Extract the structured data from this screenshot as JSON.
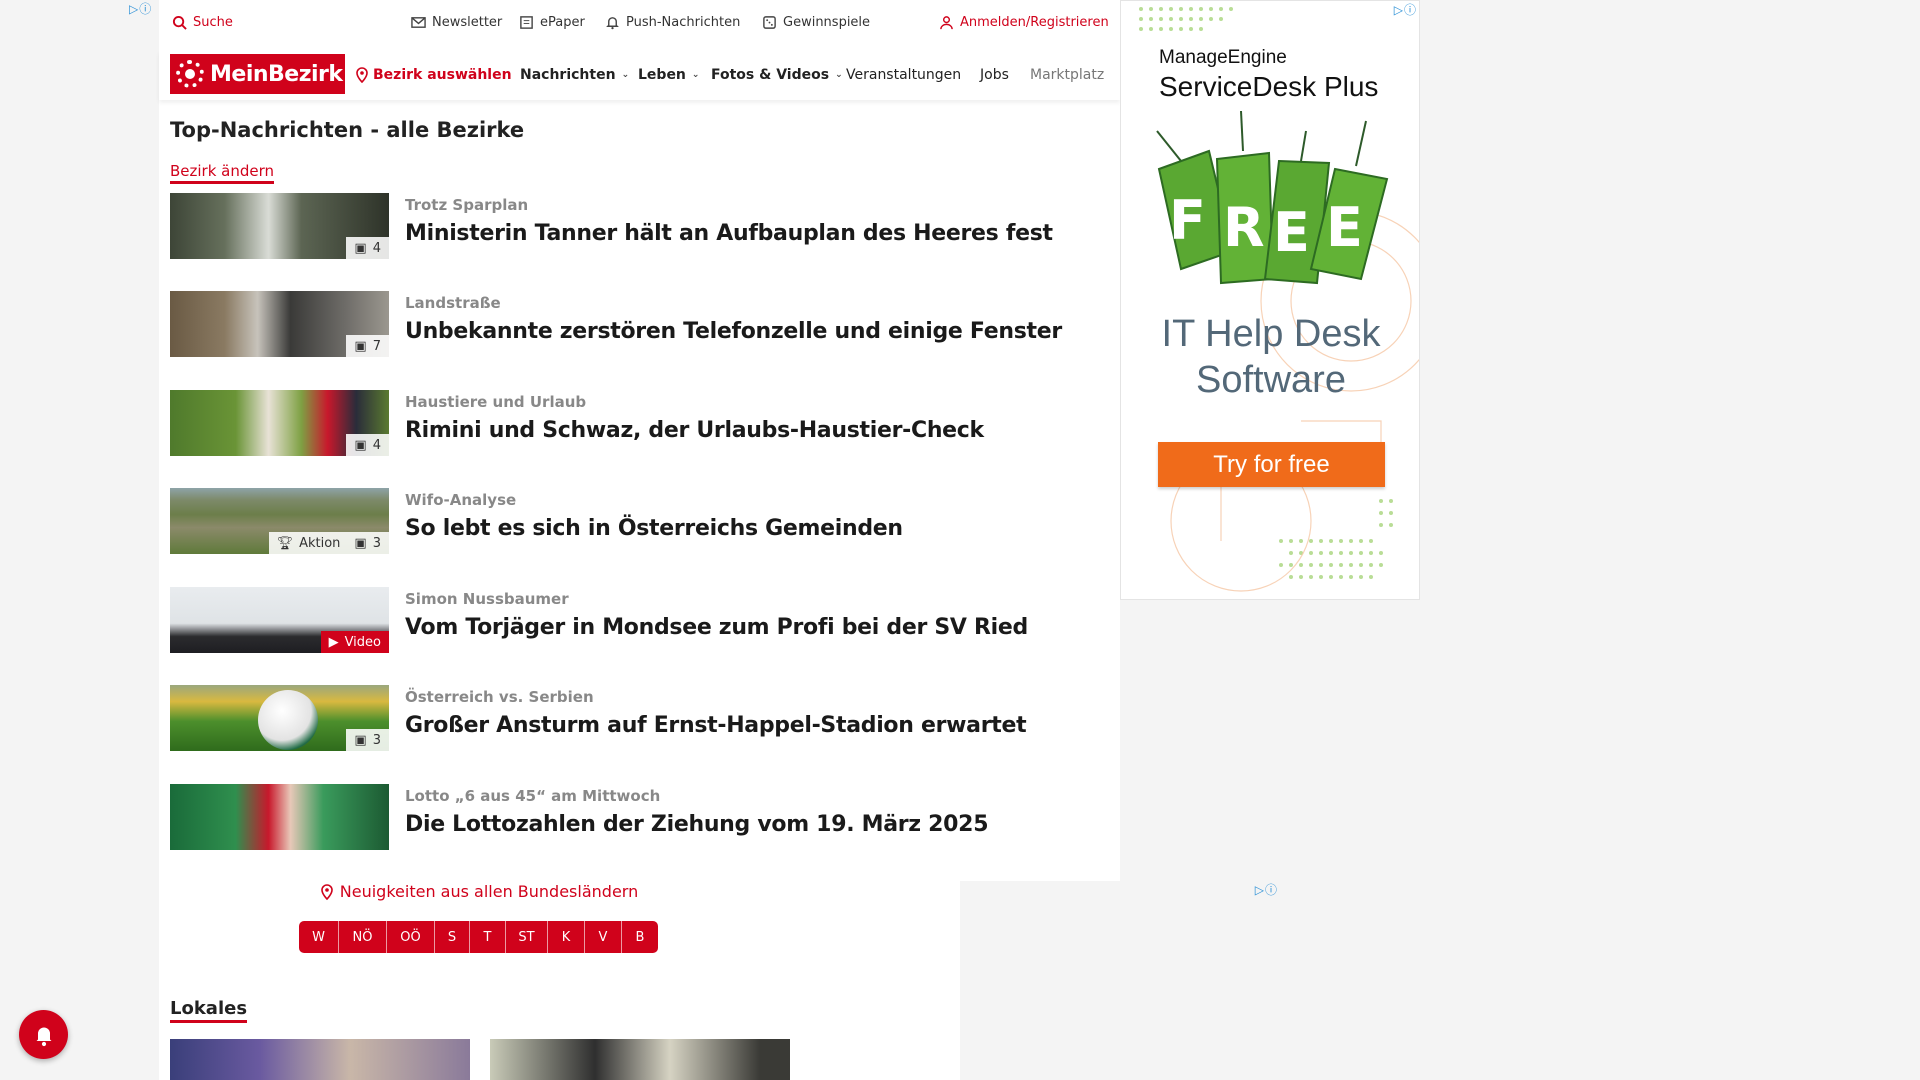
{
  "topbar": {
    "search": "Suche",
    "newsletter": "Newsletter",
    "epaper": "ePaper",
    "push": "Push-Nachrichten",
    "gewinnspiele": "Gewinnspiele",
    "login": "Anmelden/Registrieren"
  },
  "nav": {
    "logo": "MeinBezirk",
    "bezirk": "Bezirk auswählen",
    "nachrichten": "Nachrichten",
    "leben": "Leben",
    "fotos": "Fotos & Videos",
    "veranstaltungen": "Veranstaltungen",
    "jobs": "Jobs",
    "marktplatz": "Marktplatz"
  },
  "section": {
    "title": "Top-Nachrichten - alle Bezirke",
    "change_link": "Bezirk ändern"
  },
  "articles": [
    {
      "kicker": "Trotz Sparplan",
      "title": "Ministerin Tanner hält an Aufbauplan des Heeres fest",
      "badge": "4",
      "aktion": "",
      "video": ""
    },
    {
      "kicker": "Landstraße",
      "title": "Unbekannte zerstören Telefonzelle und einige Fenster",
      "badge": "7",
      "aktion": "",
      "video": ""
    },
    {
      "kicker": "Haustiere und Urlaub",
      "title": "Rimini und Schwaz, der Urlaubs-Haustier-Check",
      "badge": "4",
      "aktion": "",
      "video": ""
    },
    {
      "kicker": "Wifo-Analyse",
      "title": "So lebt es sich in Österreichs Gemeinden",
      "badge": "3",
      "aktion": "Aktion",
      "video": ""
    },
    {
      "kicker": "Simon Nussbaumer",
      "title": "Vom Torjäger in Mondsee zum Profi bei der SV Ried",
      "badge": "",
      "aktion": "",
      "video": "Video"
    },
    {
      "kicker": "Österreich vs. Serbien",
      "title": "Großer Ansturm auf Ernst-Happel-Stadion erwartet",
      "badge": "3",
      "aktion": "",
      "video": ""
    },
    {
      "kicker": "Lotto „6 aus 45“ am Mittwoch",
      "title": "Die Lottozahlen der Ziehung vom 19. März 2025",
      "badge": "",
      "aktion": "",
      "video": ""
    }
  ],
  "bundeslaender": {
    "title": "Neuigkeiten aus allen Bundesländern",
    "buttons": [
      "W",
      "NÖ",
      "OÖ",
      "S",
      "T",
      "ST",
      "K",
      "V",
      "B"
    ]
  },
  "lokales": {
    "title": "Lokales"
  },
  "ad": {
    "brand1": "ManageEngine",
    "brand2": "ServiceDesk Plus",
    "tag": "FREE",
    "headline1": "IT Help Desk",
    "headline2": "Software",
    "cta": "Try for free"
  },
  "colors": {
    "brand_red": "#d0021b",
    "ad_orange": "#f06b1a",
    "ad_green": "#5aa832"
  },
  "icons": [
    "search-icon",
    "mail-icon",
    "newspaper-icon",
    "bell-icon",
    "dice-icon",
    "user-icon",
    "location-pin-icon",
    "chevron-down-icon",
    "gallery-icon",
    "trophy-icon",
    "play-icon",
    "adchoices-icon"
  ]
}
